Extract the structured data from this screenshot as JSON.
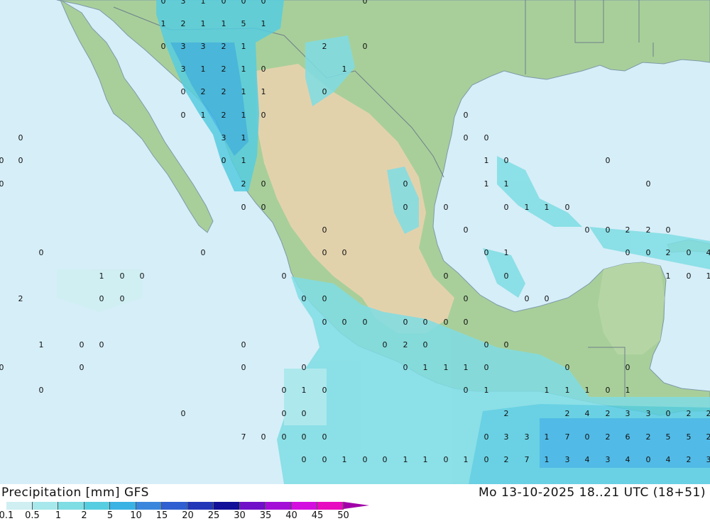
{
  "map": {
    "legend_title": "Precipitation [mm]",
    "model": "GFS",
    "timestamp": "Mo 13-10-2025 18..21 UTC (18+51)",
    "legend_labels": [
      "0.1",
      "0.5",
      "1",
      "2",
      "5",
      "10",
      "15",
      "20",
      "25",
      "30",
      "35",
      "40",
      "45",
      "50"
    ],
    "legend_colors": [
      "#cfeff2",
      "#a7e8ec",
      "#7fdde4",
      "#56cde0",
      "#3ab2e4",
      "#3a86dc",
      "#2f5fd0",
      "#2237b8",
      "#120f98",
      "#7010c8",
      "#a40fd8",
      "#d30fe0",
      "#e70cc0"
    ],
    "ocean_color": "#d6eef8",
    "land_color": "#a8cf9a",
    "plateau_color": "#e2d2ac",
    "values": [
      {
        "t": "0"
      },
      {
        "t": "3"
      },
      {
        "t": "1"
      },
      {
        "t": "0"
      },
      {
        "t": "0"
      },
      {
        "t": "0"
      },
      {
        "t": "0"
      },
      {
        "t": "1"
      },
      {
        "t": "2"
      },
      {
        "t": "1"
      },
      {
        "t": "1"
      },
      {
        "t": "5"
      },
      {
        "t": "1"
      },
      {
        "t": "0"
      },
      {
        "t": "3"
      },
      {
        "t": "3"
      },
      {
        "t": "2"
      },
      {
        "t": "1"
      },
      {
        "t": "2"
      },
      {
        "t": "0"
      },
      {
        "t": "3"
      },
      {
        "t": "1"
      },
      {
        "t": "2"
      },
      {
        "t": "1"
      },
      {
        "t": "0"
      },
      {
        "t": "1"
      },
      {
        "t": "0"
      },
      {
        "t": "2"
      },
      {
        "t": "2"
      },
      {
        "t": "1"
      },
      {
        "t": "1"
      },
      {
        "t": "0"
      },
      {
        "t": "0"
      },
      {
        "t": "1"
      },
      {
        "t": "2"
      },
      {
        "t": "1"
      },
      {
        "t": "0"
      },
      {
        "t": "0"
      },
      {
        "t": "0"
      },
      {
        "t": "3"
      },
      {
        "t": "1"
      },
      {
        "t": "0"
      },
      {
        "t": "0"
      },
      {
        "t": "0"
      },
      {
        "t": "0"
      },
      {
        "t": "0"
      },
      {
        "t": "1"
      },
      {
        "t": "1"
      },
      {
        "t": "0"
      },
      {
        "t": "0"
      },
      {
        "t": "0"
      },
      {
        "t": "2"
      },
      {
        "t": "0"
      },
      {
        "t": "0"
      },
      {
        "t": "1"
      },
      {
        "t": "1"
      },
      {
        "t": "0"
      },
      {
        "t": "0"
      },
      {
        "t": "0"
      },
      {
        "t": "0"
      },
      {
        "t": "0"
      },
      {
        "t": "0"
      },
      {
        "t": "1"
      },
      {
        "t": "1"
      },
      {
        "t": "0"
      },
      {
        "t": "0"
      },
      {
        "t": "0"
      },
      {
        "t": "0"
      },
      {
        "t": "0"
      },
      {
        "t": "2"
      },
      {
        "t": "2"
      },
      {
        "t": "0"
      },
      {
        "t": "0"
      },
      {
        "t": "0"
      },
      {
        "t": "0"
      },
      {
        "t": "0"
      },
      {
        "t": "0"
      },
      {
        "t": "1"
      },
      {
        "t": "0"
      },
      {
        "t": "0"
      },
      {
        "t": "2"
      },
      {
        "t": "0"
      },
      {
        "t": "4"
      },
      {
        "t": "1"
      },
      {
        "t": "0"
      },
      {
        "t": "0"
      },
      {
        "t": "0"
      },
      {
        "t": "0"
      },
      {
        "t": "0"
      },
      {
        "t": "1"
      },
      {
        "t": "0"
      },
      {
        "t": "1"
      },
      {
        "t": "2"
      },
      {
        "t": "0"
      },
      {
        "t": "0"
      },
      {
        "t": "0"
      },
      {
        "t": "0"
      },
      {
        "t": "0"
      },
      {
        "t": "0"
      },
      {
        "t": "0"
      },
      {
        "t": "0"
      },
      {
        "t": "0"
      },
      {
        "t": "0"
      },
      {
        "t": "0"
      },
      {
        "t": "0"
      },
      {
        "t": "0"
      },
      {
        "t": "0"
      },
      {
        "t": "1"
      },
      {
        "t": "0"
      },
      {
        "t": "0"
      },
      {
        "t": "0"
      },
      {
        "t": "0"
      },
      {
        "t": "2"
      },
      {
        "t": "0"
      },
      {
        "t": "0"
      },
      {
        "t": "0"
      },
      {
        "t": "0"
      },
      {
        "t": "0"
      },
      {
        "t": "0"
      },
      {
        "t": "0"
      },
      {
        "t": "0"
      },
      {
        "t": "1"
      },
      {
        "t": "1"
      },
      {
        "t": "1"
      },
      {
        "t": "0"
      },
      {
        "t": "0"
      },
      {
        "t": "0"
      },
      {
        "t": "0"
      },
      {
        "t": "0"
      },
      {
        "t": "1"
      },
      {
        "t": "0"
      },
      {
        "t": "0"
      },
      {
        "t": "1"
      },
      {
        "t": "1"
      },
      {
        "t": "1"
      },
      {
        "t": "1"
      },
      {
        "t": "0"
      },
      {
        "t": "1"
      },
      {
        "t": "0"
      },
      {
        "t": "0"
      },
      {
        "t": "0"
      },
      {
        "t": "2"
      },
      {
        "t": "2"
      },
      {
        "t": "4"
      },
      {
        "t": "2"
      },
      {
        "t": "3"
      },
      {
        "t": "3"
      },
      {
        "t": "0"
      },
      {
        "t": "2"
      },
      {
        "t": "2"
      },
      {
        "t": "7"
      },
      {
        "t": "0"
      },
      {
        "t": "0"
      },
      {
        "t": "0"
      },
      {
        "t": "0"
      },
      {
        "t": "0"
      },
      {
        "t": "3"
      },
      {
        "t": "3"
      },
      {
        "t": "1"
      },
      {
        "t": "7"
      },
      {
        "t": "0"
      },
      {
        "t": "2"
      },
      {
        "t": "6"
      },
      {
        "t": "2"
      },
      {
        "t": "5"
      },
      {
        "t": "5"
      },
      {
        "t": "2"
      },
      {
        "t": "0"
      },
      {
        "t": "0"
      },
      {
        "t": "1"
      },
      {
        "t": "0"
      },
      {
        "t": "0"
      },
      {
        "t": "1"
      },
      {
        "t": "1"
      },
      {
        "t": "0"
      },
      {
        "t": "1"
      },
      {
        "t": "0"
      },
      {
        "t": "2"
      },
      {
        "t": "7"
      },
      {
        "t": "1"
      },
      {
        "t": "3"
      },
      {
        "t": "4"
      },
      {
        "t": "3"
      },
      {
        "t": "4"
      },
      {
        "t": "0"
      },
      {
        "t": "4"
      },
      {
        "t": "2"
      },
      {
        "t": "3"
      }
    ]
  }
}
